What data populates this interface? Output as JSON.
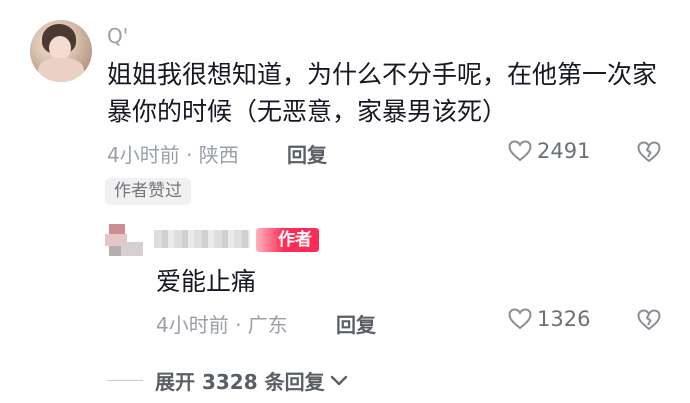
{
  "comment": {
    "username": "Q'",
    "text": "姐姐我很想知道，为什么不分手呢，在他第一次家暴你的时候（无恶意，家暴男该死）",
    "time_location": "4小时前 · 陕西",
    "reply_label": "回复",
    "like_count": "2491",
    "author_liked_badge": "作者赞过"
  },
  "reply": {
    "author_tag": "作者",
    "text": "爱能止痛",
    "time_location": "4小时前 · 广东",
    "reply_label": "回复",
    "like_count": "1326"
  },
  "expand": {
    "label": "展开 3328 条回复"
  },
  "colors": {
    "text_primary": "#161823",
    "text_secondary": "#9aa0a6",
    "author_tag": "#fe2c55"
  },
  "icons": [
    "heart-outline-icon",
    "broken-heart-icon",
    "chevron-down-icon"
  ]
}
